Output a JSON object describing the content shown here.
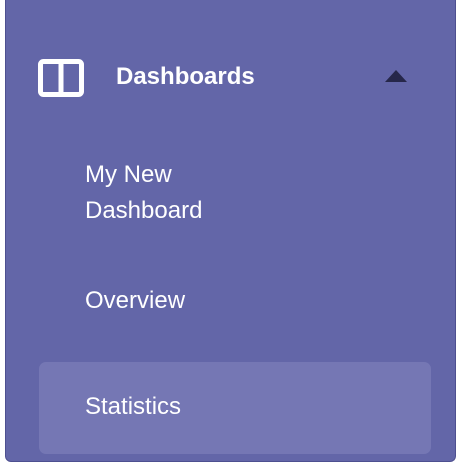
{
  "sidebar": {
    "section": {
      "title": "Dashboards",
      "icon": "dashboard-layout-icon",
      "chevron": "chevron-up-icon",
      "expanded": true
    },
    "items": [
      {
        "label": "My New Dashboard",
        "active": false
      },
      {
        "label": "Overview",
        "active": false
      },
      {
        "label": "Statistics",
        "active": true
      }
    ]
  },
  "colors": {
    "panel_background": "#6366a8",
    "active_item_background": "#7577b4",
    "text": "#ffffff",
    "chevron": "#26274a"
  }
}
